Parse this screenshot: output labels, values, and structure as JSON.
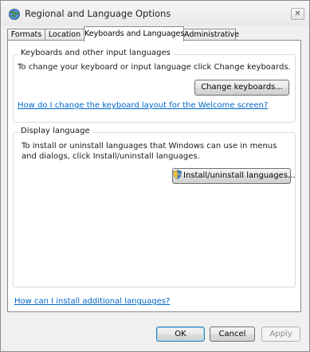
{
  "window": {
    "title": "Regional and Language Options",
    "close_glyph": "✕"
  },
  "tabs": [
    {
      "label": "Formats"
    },
    {
      "label": "Location"
    },
    {
      "label": "Keyboards and Languages"
    },
    {
      "label": "Administrative"
    }
  ],
  "keyboards_group": {
    "legend": "Keyboards and other input languages",
    "description": "To change your keyboard or input language click Change keyboards.",
    "change_button": "Change keyboards...",
    "welcome_link": "How do I change the keyboard layout for the Welcome screen?"
  },
  "display_group": {
    "legend": "Display language",
    "description": "To install or uninstall languages that Windows can use in menus and dialogs, click Install/uninstall languages.",
    "install_button": "Install/uninstall languages..."
  },
  "help_link": "How can I install additional languages?",
  "footer": {
    "ok": "OK",
    "cancel": "Cancel",
    "apply": "Apply"
  },
  "icons": {
    "title": "globe-icon",
    "shield": "uac-shield-icon"
  }
}
